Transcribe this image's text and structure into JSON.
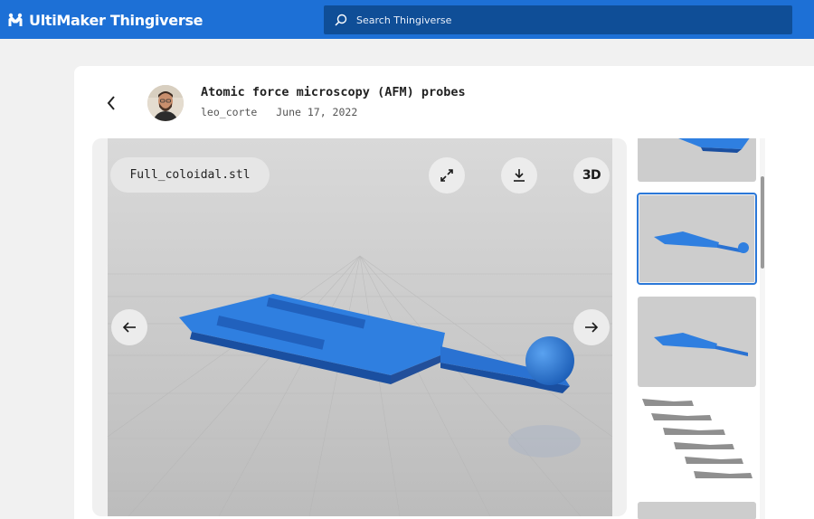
{
  "header": {
    "brand": "UltiMaker Thingiverse",
    "search_placeholder": "Search Thingiverse"
  },
  "thing": {
    "title": "Atomic force microscopy (AFM) probes",
    "author": "leo_corte",
    "date": "June 17, 2022"
  },
  "viewer": {
    "file_name": "Full_coloidal.stl",
    "view_mode_label": "3D",
    "model_color": "#2f7fe0"
  },
  "thumbnails": [
    {
      "name": "thumb-1",
      "selected": false
    },
    {
      "name": "thumb-2",
      "selected": true
    },
    {
      "name": "thumb-3",
      "selected": false
    },
    {
      "name": "thumb-4",
      "selected": false
    }
  ],
  "colors": {
    "brand_blue": "#1d70d6",
    "search_bg": "#0f4e97",
    "accent": "#2b78d8"
  },
  "icons": [
    "ultimaker-logo-icon",
    "search-icon",
    "back-arrow-icon",
    "expand-icon",
    "download-icon",
    "prev-arrow-icon",
    "next-arrow-icon"
  ]
}
